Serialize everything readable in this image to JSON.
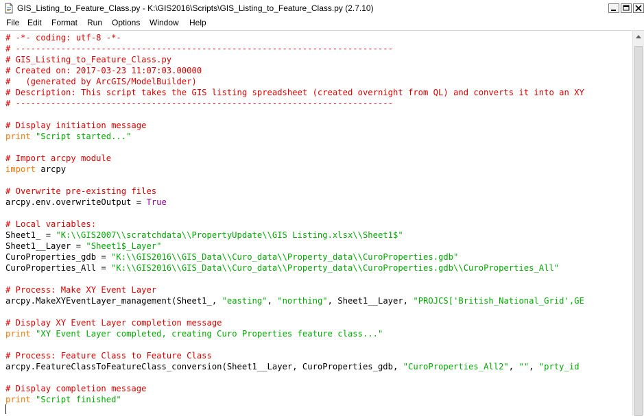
{
  "window": {
    "title": "GIS_Listing_to_Feature_Class.py - K:\\GIS2016\\Scripts\\GIS_Listing_to_Feature_Class.py (2.7.10)",
    "icon": "idle-file-icon",
    "controls": {
      "minimize": "_",
      "maximize": "□",
      "close": "X"
    }
  },
  "menu": {
    "items": [
      "File",
      "Edit",
      "Format",
      "Run",
      "Options",
      "Window",
      "Help"
    ]
  },
  "editor": {
    "lines": [
      [
        {
          "t": "# -*- coding: utf-8 -*-",
          "c": "c"
        }
      ],
      [
        {
          "t": "# ---------------------------------------------------------------------------",
          "c": "c"
        }
      ],
      [
        {
          "t": "# GIS_Listing_to_Feature_Class.py",
          "c": "c"
        }
      ],
      [
        {
          "t": "# Created on: 2017-03-23 11:07:03.00000",
          "c": "c"
        }
      ],
      [
        {
          "t": "#   (generated by ArcGIS/ModelBuilder)",
          "c": "c"
        }
      ],
      [
        {
          "t": "# Description: This script takes the GIS listing spreadsheet (created overnight from QL) and converts it into an XY",
          "c": "c"
        }
      ],
      [
        {
          "t": "# ---------------------------------------------------------------------------",
          "c": "c"
        }
      ],
      [],
      [
        {
          "t": "# Display initiation message",
          "c": "c"
        }
      ],
      [
        {
          "t": "print",
          "c": "k"
        },
        {
          "t": " ",
          "c": ""
        },
        {
          "t": "\"Script started...\"",
          "c": "s"
        }
      ],
      [],
      [
        {
          "t": "# Import arcpy module",
          "c": "c"
        }
      ],
      [
        {
          "t": "import",
          "c": "k"
        },
        {
          "t": " arcpy",
          "c": ""
        }
      ],
      [],
      [
        {
          "t": "# Overwrite pre-existing files",
          "c": "c"
        }
      ],
      [
        {
          "t": "arcpy.env.overwriteOutput = ",
          "c": ""
        },
        {
          "t": "True",
          "c": "bi"
        }
      ],
      [],
      [
        {
          "t": "# Local variables:",
          "c": "c"
        }
      ],
      [
        {
          "t": "Sheet1_ = ",
          "c": ""
        },
        {
          "t": "\"K:\\\\GIS2007\\\\scratchdata\\\\PropertyUpdate\\\\GIS Listing.xlsx\\\\Sheet1$\"",
          "c": "s"
        }
      ],
      [
        {
          "t": "Sheet1__Layer = ",
          "c": ""
        },
        {
          "t": "\"Sheet1$_Layer\"",
          "c": "s"
        }
      ],
      [
        {
          "t": "CuroProperties_gdb = ",
          "c": ""
        },
        {
          "t": "\"K:\\\\GIS2016\\\\GIS_Data\\\\Curo_data\\\\Property_data\\\\CuroProperties.gdb\"",
          "c": "s"
        }
      ],
      [
        {
          "t": "CuroProperties_All = ",
          "c": ""
        },
        {
          "t": "\"K:\\\\GIS2016\\\\GIS_Data\\\\Curo_data\\\\Property_data\\\\CuroProperties.gdb\\\\CuroProperties_All\"",
          "c": "s"
        }
      ],
      [],
      [
        {
          "t": "# Process: Make XY Event Layer",
          "c": "c"
        }
      ],
      [
        {
          "t": "arcpy.MakeXYEventLayer_management(Sheet1_, ",
          "c": ""
        },
        {
          "t": "\"easting\"",
          "c": "s"
        },
        {
          "t": ", ",
          "c": ""
        },
        {
          "t": "\"northing\"",
          "c": "s"
        },
        {
          "t": ", Sheet1__Layer, ",
          "c": ""
        },
        {
          "t": "\"PROJCS['British_National_Grid',GE",
          "c": "s"
        }
      ],
      [],
      [
        {
          "t": "# Display XY Event Layer completion message",
          "c": "c"
        }
      ],
      [
        {
          "t": "print",
          "c": "k"
        },
        {
          "t": " ",
          "c": ""
        },
        {
          "t": "\"XY Event Layer completed, creating Curo Properties feature class...\"",
          "c": "s"
        }
      ],
      [],
      [
        {
          "t": "# Process: Feature Class to Feature Class",
          "c": "c"
        }
      ],
      [
        {
          "t": "arcpy.FeatureClassToFeatureClass_conversion(Sheet1__Layer, CuroProperties_gdb, ",
          "c": ""
        },
        {
          "t": "\"CuroProperties_All2\"",
          "c": "s"
        },
        {
          "t": ", ",
          "c": ""
        },
        {
          "t": "\"\"",
          "c": "s"
        },
        {
          "t": ", ",
          "c": ""
        },
        {
          "t": "\"prty_id",
          "c": "s"
        }
      ],
      [],
      [
        {
          "t": "# Display completion message",
          "c": "c"
        }
      ],
      [
        {
          "t": "print",
          "c": "k"
        },
        {
          "t": " ",
          "c": ""
        },
        {
          "t": "\"Script finished\"",
          "c": "s"
        }
      ]
    ]
  },
  "colors": {
    "comment": "#dd0000",
    "keyword": "#ff7700",
    "string": "#00aa00",
    "builtin": "#900090"
  }
}
